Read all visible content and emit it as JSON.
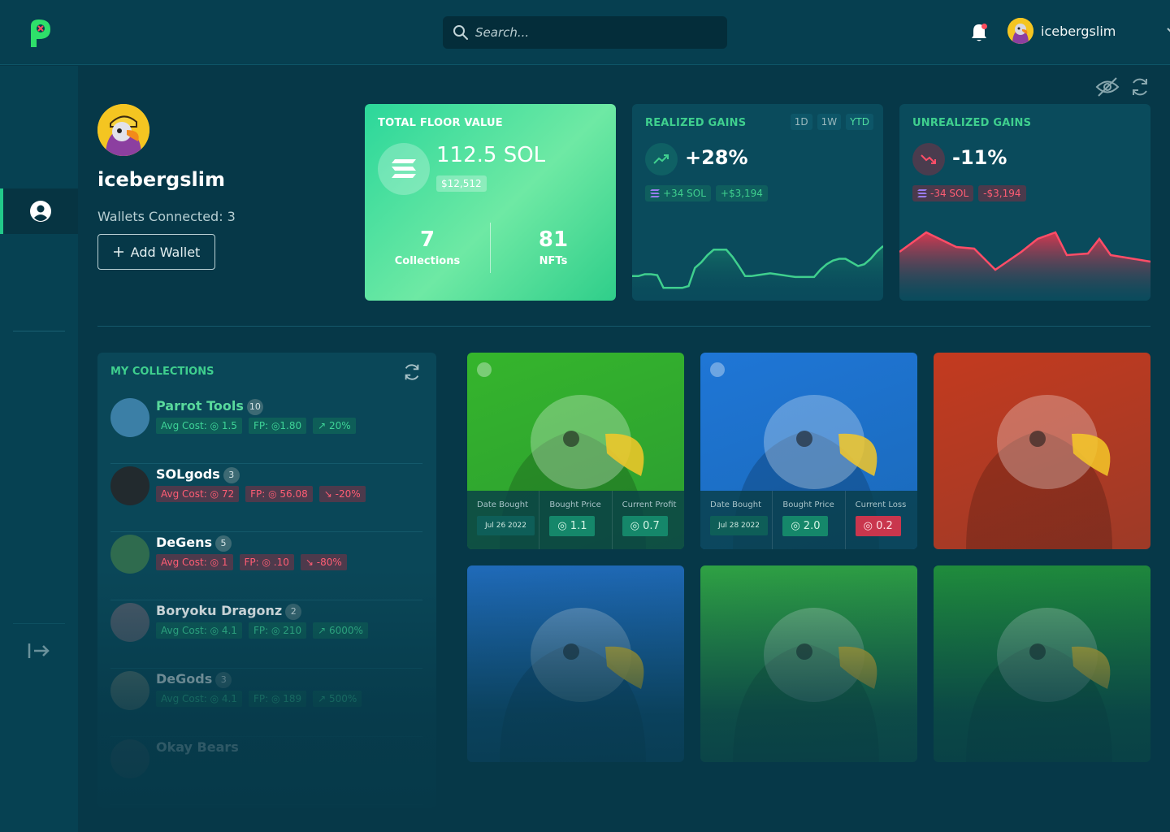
{
  "header": {
    "search_placeholder": "Search...",
    "username": "icebergslim"
  },
  "profile": {
    "name": "icebergslim",
    "wallets_connected": "Wallets Connected: 3",
    "add_wallet_label": "Add Wallet"
  },
  "floor_card": {
    "label": "TOTAL FLOOR VALUE",
    "value": "112.5 SOL",
    "usd": "$12,512",
    "collections_count": "7",
    "collections_label": "Collections",
    "nfts_count": "81",
    "nfts_label": "NFTs"
  },
  "realized": {
    "label": "REALIZED GAINS",
    "pct": "+28%",
    "sol": "+34 SOL",
    "usd": "+$3,194",
    "timeframes": [
      "1D",
      "1W",
      "YTD"
    ],
    "active_timeframe": "YTD",
    "accent": "#3fcf8e",
    "trend": [
      0.27,
      0.27,
      0.29,
      0.29,
      0.28,
      0.14,
      0.14,
      0.14,
      0.14,
      0.16,
      0.36,
      0.42,
      0.5,
      0.56,
      0.56,
      0.56,
      0.48,
      0.38,
      0.27,
      0.27,
      0.28,
      0.29,
      0.3,
      0.29,
      0.28,
      0.27,
      0.26,
      0.26,
      0.26,
      0.26,
      0.34,
      0.4,
      0.44,
      0.46,
      0.46,
      0.42,
      0.38,
      0.4,
      0.46,
      0.54,
      0.6
    ]
  },
  "unrealized": {
    "label": "UNREALIZED GAINS",
    "pct": "-11%",
    "sol": "-34 SOL",
    "usd": "-$3,194",
    "accent": "#ff4d67"
  },
  "collections": {
    "title": "MY COLLECTIONS",
    "items": [
      {
        "name": "Parrot Tools",
        "count": "10",
        "avg": "Avg Cost: ◎ 1.5",
        "fp": "FP: ◎1.80",
        "chg": "↗ 20%",
        "tone": "g"
      },
      {
        "name": "SOLgods",
        "count": "3",
        "avg": "Avg Cost: ◎ 72",
        "fp": "FP: ◎ 56.08",
        "chg": "↘ -20%",
        "tone": "r"
      },
      {
        "name": "DeGens",
        "count": "5",
        "avg": "Avg Cost: ◎ 1",
        "fp": "FP: ◎ .10",
        "chg": "↘ -80%",
        "tone": "r"
      },
      {
        "name": "Boryoku Dragonz",
        "count": "2",
        "avg": "Avg Cost: ◎ 4.1",
        "fp": "FP: ◎ 210",
        "chg": "↗ 6000%",
        "tone": "g"
      },
      {
        "name": "DeGods",
        "count": "3",
        "avg": "Avg Cost: ◎ 4.1",
        "fp": "FP: ◎ 189",
        "chg": "↗ 500%",
        "tone": "g"
      },
      {
        "name": "Okay Bears",
        "count": "",
        "avg": "",
        "fp": "",
        "chg": "",
        "tone": "g"
      }
    ]
  },
  "nfts": [
    {
      "date_label": "Date Bought",
      "date": "Jul 26 2022",
      "price_label": "Bought Price",
      "price": "◎ 1.1",
      "result_label": "Current Profit",
      "result": "◎ 0.7",
      "result_tone": "gr",
      "bg": "#35b52c"
    },
    {
      "date_label": "Date Bought",
      "date": "Jul 28 2022",
      "price_label": "Bought Price",
      "price": "◎ 2.0",
      "result_label": "Current Loss",
      "result": "◎ 0.2",
      "result_tone": "rd",
      "bg": "#1f76d6"
    },
    {
      "bg": "#c33a1f"
    },
    {
      "bg": "#1f6ab8"
    },
    {
      "bg": "#2ea044"
    },
    {
      "bg": "#1f8b3c"
    }
  ]
}
